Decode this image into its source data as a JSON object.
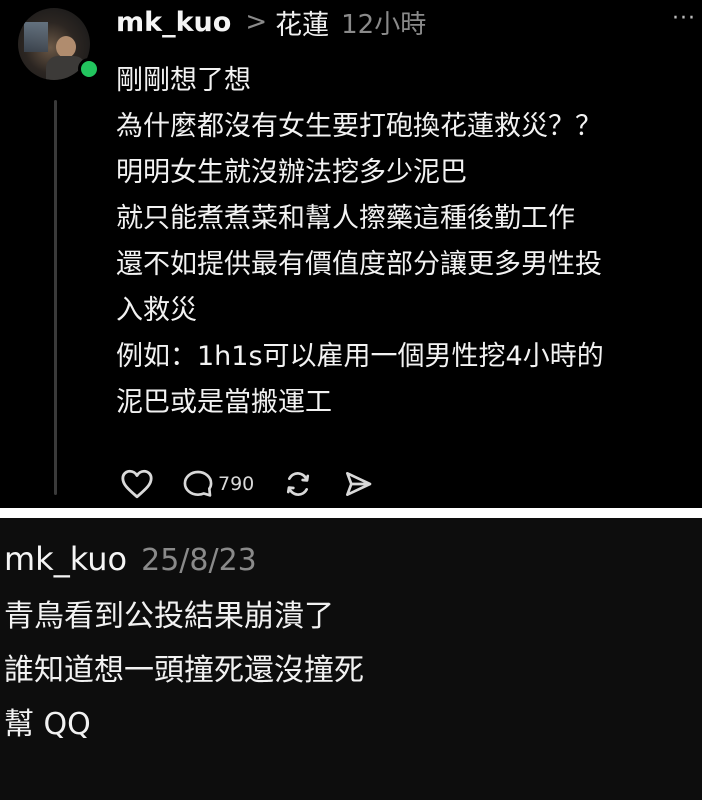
{
  "post": {
    "username": "mk_kuo",
    "chevron": ">",
    "topic": "花蓮",
    "time": "12小時",
    "more": "···",
    "body": [
      "剛剛想了想",
      "為什麼都沒有女生要打砲換花蓮救災？？",
      "明明女生就沒辦法挖多少泥巴",
      "就只能煮煮菜和幫人擦藥這種後勤工作",
      "還不如提供最有價值度部分讓更多男性投",
      "入救災",
      "例如：1h1s可以雇用一個男性挖4小時的",
      "泥巴或是當搬運工"
    ],
    "actions": {
      "like_icon": "heart-icon",
      "comment_icon": "comment-bubble-icon",
      "comment_count": "790",
      "repost_icon": "repost-icon",
      "share_icon": "send-icon"
    },
    "online_color": "#22c55e"
  },
  "reply": {
    "username": "mk_kuo",
    "date": "25/8/23",
    "body": [
      "青鳥看到公投結果崩潰了",
      "誰知道想一頭撞死還沒撞死",
      "幫 QQ"
    ]
  }
}
